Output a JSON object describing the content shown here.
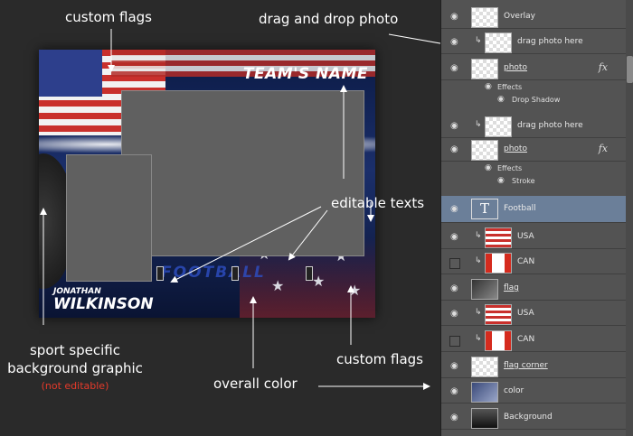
{
  "annotations": {
    "custom_flags_top": "custom flags",
    "drag_drop": "drag and drop photo",
    "editable_texts": "editable texts",
    "sport_bg_line1": "sport specific",
    "sport_bg_line2": "background graphic",
    "not_editable": "(not editable)",
    "overall_color": "overall color",
    "custom_flags_bottom": "custom flags"
  },
  "template": {
    "team_name": "TEAM'S NAME",
    "football_text": "FOOTBALL",
    "first_name": "JONATHAN",
    "last_name": "WILKINSON"
  },
  "layers": [
    {
      "name": "Overlay",
      "visible": true,
      "clipped": false,
      "underline": false
    },
    {
      "name": "drag photo here",
      "visible": true,
      "clipped": true,
      "underline": false
    },
    {
      "name": "photo",
      "visible": true,
      "clipped": false,
      "underline": true,
      "fx": "fx"
    },
    {
      "name": "Effects",
      "sub": true
    },
    {
      "name": "Drop Shadow",
      "sub": true
    },
    {
      "name": "drag photo here",
      "visible": true,
      "clipped": true,
      "underline": false
    },
    {
      "name": "photo",
      "visible": true,
      "clipped": false,
      "underline": true,
      "fx": "fx"
    },
    {
      "name": "Effects",
      "sub": true
    },
    {
      "name": "Stroke",
      "sub": true
    },
    {
      "name": "Football",
      "visible": true,
      "clipped": false,
      "selected": true,
      "text_layer": "T"
    },
    {
      "name": "USA",
      "visible": true,
      "clipped": true
    },
    {
      "name": "CAN",
      "visible": false,
      "clipped": true
    },
    {
      "name": "flag",
      "visible": true,
      "clipped": false,
      "underline": true
    },
    {
      "name": "USA",
      "visible": true,
      "clipped": true
    },
    {
      "name": "CAN",
      "visible": false,
      "clipped": true
    },
    {
      "name": "flag corner",
      "visible": true,
      "clipped": false,
      "underline": true
    },
    {
      "name": "color",
      "visible": true,
      "clipped": false
    },
    {
      "name": "Background",
      "visible": true,
      "clipped": false
    }
  ],
  "colors": {
    "selected_row": "#6b7f99",
    "panel_bg": "#535353",
    "page_bg": "#2a2a2a",
    "not_editable_red": "#e53a2a"
  }
}
